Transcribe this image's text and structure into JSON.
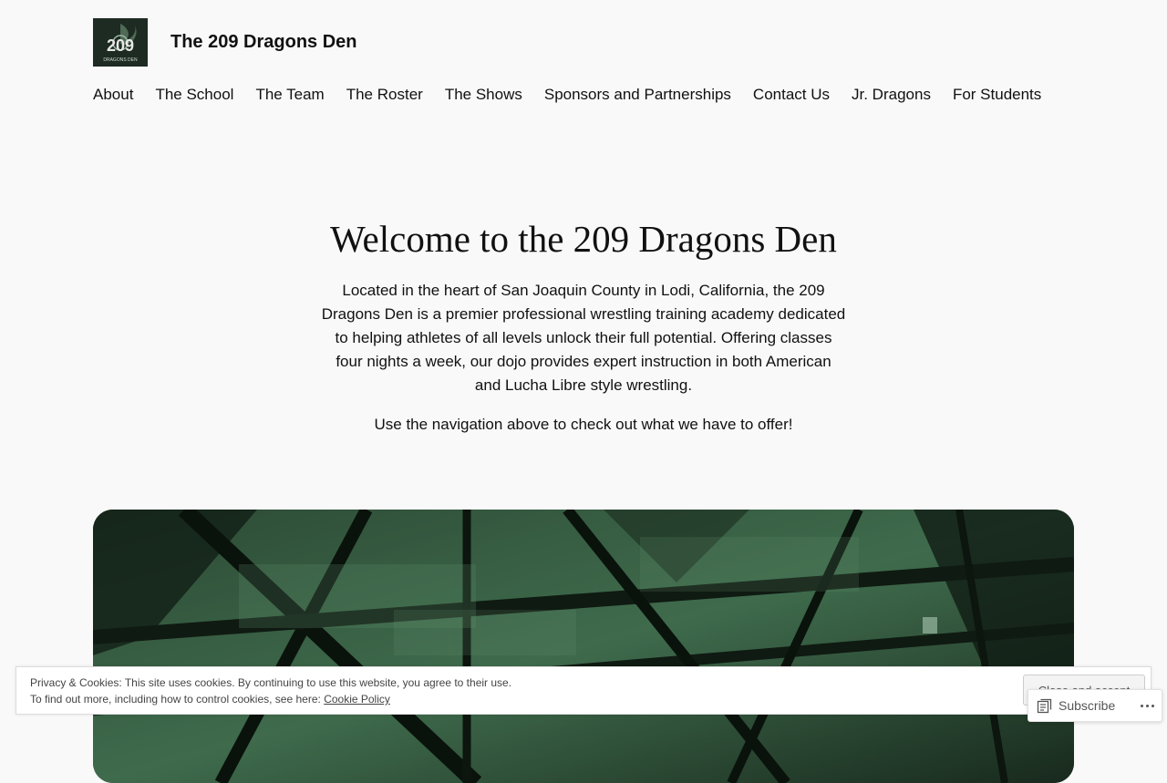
{
  "site": {
    "title": "The 209 Dragons Den",
    "logo_alt": "209 Dragons Den",
    "logo_number": "209",
    "logo_subtext": "DRAGONS DEN"
  },
  "nav": [
    {
      "label": "About"
    },
    {
      "label": "The School"
    },
    {
      "label": "The Team"
    },
    {
      "label": "The Roster"
    },
    {
      "label": "The Shows"
    },
    {
      "label": "Sponsors and Partnerships"
    },
    {
      "label": "Contact Us"
    },
    {
      "label": "Jr. Dragons"
    },
    {
      "label": "For Students"
    }
  ],
  "hero": {
    "title": "Welcome to the 209 Dragons Den",
    "intro": "Located in the heart of San Joaquin County in Lodi, California, the 209 Dragons Den is a premier professional wrestling training academy dedicated to helping athletes of all levels unlock their full potential. Offering classes four nights a week, our dojo provides expert instruction in both American and Lucha Libre style wrestling.",
    "cta": "Use the navigation above to check out what we have to offer!"
  },
  "cookie": {
    "line1": "Privacy & Cookies: This site uses cookies. By continuing to use this website, you agree to their use.",
    "line2_prefix": "To find out more, including how to control cookies, see here: ",
    "link_label": "Cookie Policy",
    "accept_label": "Close and accept"
  },
  "subscribe": {
    "label": "Subscribe"
  },
  "colors": {
    "background": "#f9f9f9",
    "hero_tint": "#2d5a3a"
  }
}
